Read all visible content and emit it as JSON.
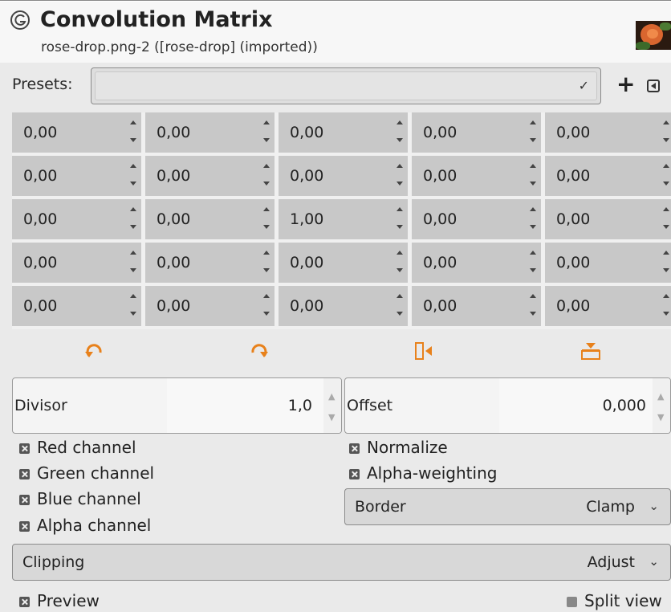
{
  "header": {
    "title": "Convolution Matrix",
    "subtitle": "rose-drop.png-2 ([rose-drop] (imported))",
    "logo_icon": "gimp-wilber-icon",
    "thumbnail": "rose-thumbnail-image"
  },
  "presets": {
    "label": "Presets:",
    "value": "",
    "add_icon": "plus-icon",
    "menu_icon": "menu-triangle-icon"
  },
  "matrix": {
    "rows": [
      [
        "0,00",
        "0,00",
        "0,00",
        "0,00",
        "0,00"
      ],
      [
        "0,00",
        "0,00",
        "0,00",
        "0,00",
        "0,00"
      ],
      [
        "0,00",
        "0,00",
        "1,00",
        "0,00",
        "0,00"
      ],
      [
        "0,00",
        "0,00",
        "0,00",
        "0,00",
        "0,00"
      ],
      [
        "0,00",
        "0,00",
        "0,00",
        "0,00",
        "0,00"
      ]
    ]
  },
  "orientation_buttons": [
    {
      "icon": "rotate-ccw-icon"
    },
    {
      "icon": "rotate-cw-icon"
    },
    {
      "icon": "flip-horizontal-icon"
    },
    {
      "icon": "flip-vertical-icon"
    }
  ],
  "divisor": {
    "label": "Divisor",
    "value": "1,0"
  },
  "offset": {
    "label": "Offset",
    "value": "0,000"
  },
  "channels": {
    "red": {
      "label": "Red channel",
      "checked": true
    },
    "green": {
      "label": "Green channel",
      "checked": true
    },
    "blue": {
      "label": "Blue channel",
      "checked": true
    },
    "alpha": {
      "label": "Alpha channel",
      "checked": true
    }
  },
  "options": {
    "normalize": {
      "label": "Normalize",
      "checked": true
    },
    "alpha_weighting": {
      "label": "Alpha-weighting",
      "checked": true
    }
  },
  "border": {
    "label": "Border",
    "value": "Clamp"
  },
  "clipping": {
    "label": "Clipping",
    "value": "Adjust"
  },
  "footer": {
    "preview": {
      "label": "Preview",
      "checked": true
    },
    "split_view": {
      "label": "Split view",
      "checked": false
    }
  },
  "colors": {
    "accent_orange": "#e8811b",
    "panel_bg": "#eaeaea",
    "cell_bg": "#c8c8c8"
  }
}
